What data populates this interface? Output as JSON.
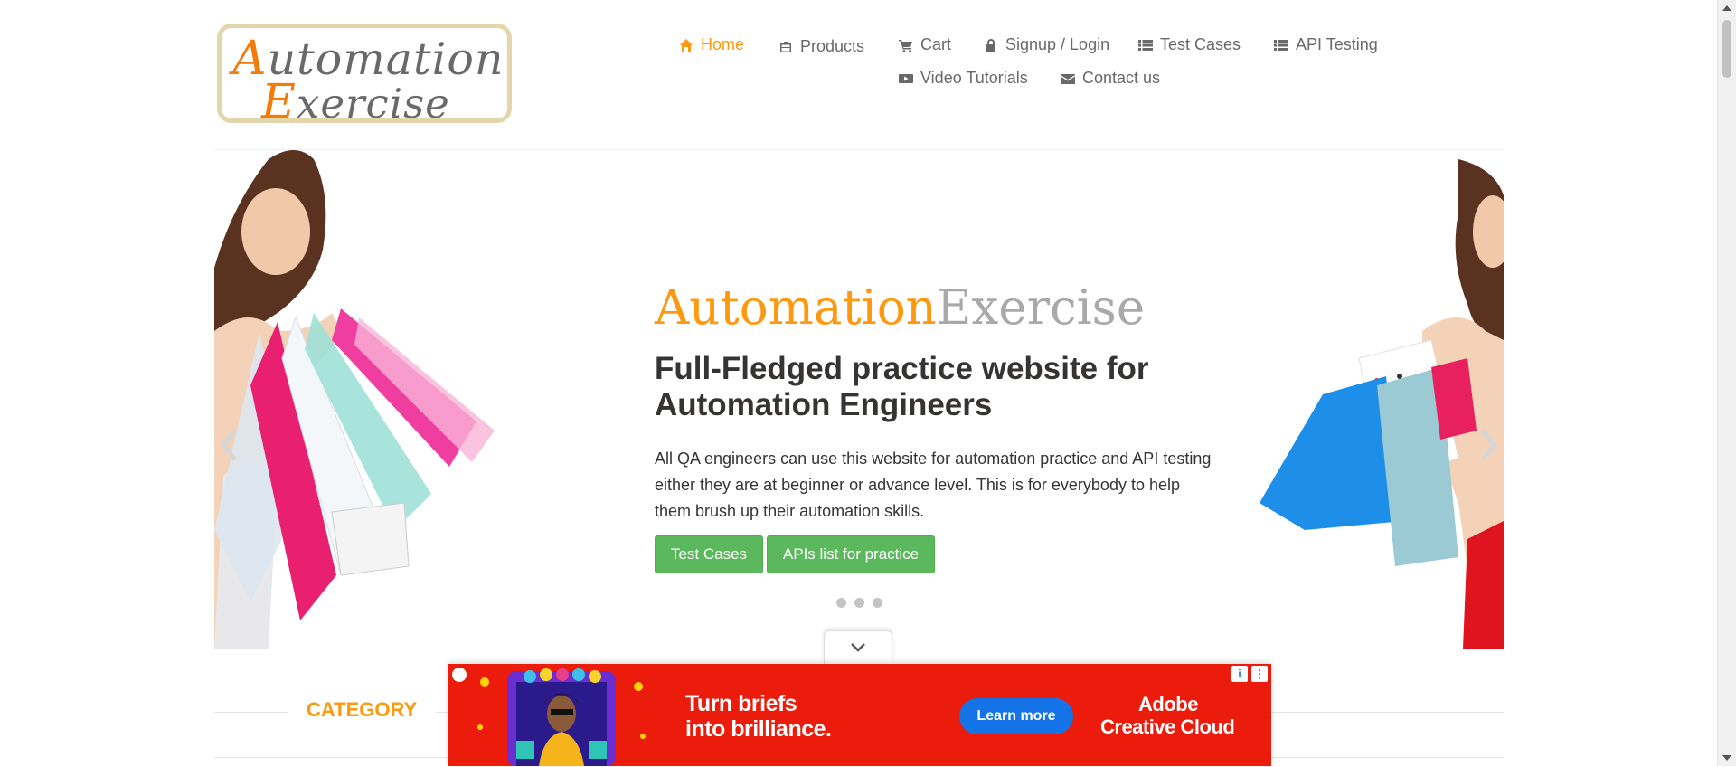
{
  "header": {
    "logo_line1": "Automation",
    "logo_line2": "Exercise",
    "nav": {
      "home": "Home",
      "products": "Products",
      "cart": "Cart",
      "signup_login": "Signup / Login",
      "test_cases": "Test Cases",
      "api_testing": "API Testing",
      "video_tutorials": "Video Tutorials",
      "contact_us": "Contact us"
    }
  },
  "slider": {
    "brand_part1": "Automation",
    "brand_part2": "Exercise",
    "headline": "Full-Fledged practice website for Automation Engineers",
    "description": "All QA engineers can use this website for automation practice and API testing either they are at beginner or advance level. This is for everybody to help them brush up their automation skills.",
    "btn_test_cases": "Test Cases",
    "btn_apis_list": "APIs list for practice",
    "indicator_count": 3
  },
  "category": {
    "title": "CATEGORY"
  },
  "ad": {
    "line1": "Turn briefs",
    "line2": "into brilliance.",
    "cta": "Learn more",
    "brand_line1": "Adobe",
    "brand_line2": "Creative Cloud",
    "info_glyph": "i",
    "more_glyph": "⋮"
  },
  "colors": {
    "accent": "#fe980f",
    "button_green": "#5cb85c",
    "nav_text": "#696969",
    "ad_background": "#ec1c0c",
    "ad_cta": "#1473e6"
  }
}
